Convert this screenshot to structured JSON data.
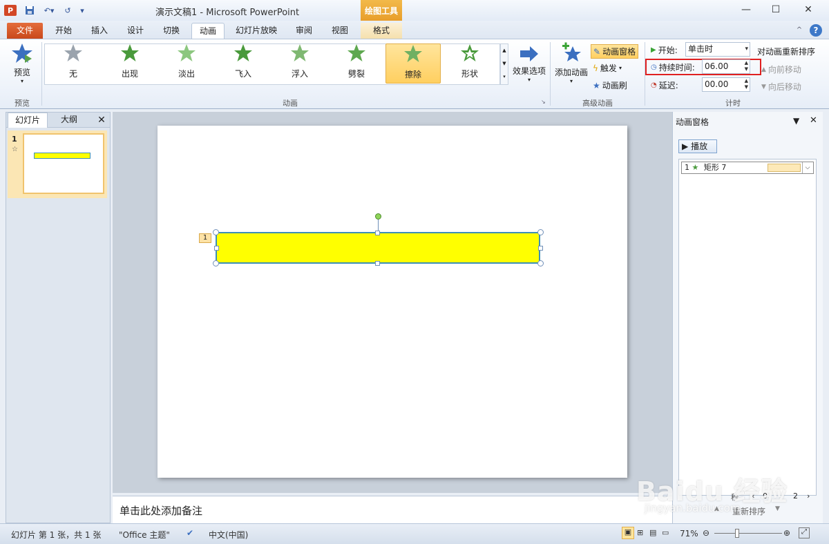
{
  "titlebar": {
    "title": "演示文稿1 - Microsoft PowerPoint",
    "context_tools": "绘图工具"
  },
  "tabs": {
    "file": "文件",
    "home": "开始",
    "insert": "插入",
    "design": "设计",
    "transitions": "切换",
    "animations": "动画",
    "slideshow": "幻灯片放映",
    "review": "审阅",
    "view": "视图",
    "format": "格式"
  },
  "ribbon": {
    "preview": {
      "button": "预览",
      "group": "预览"
    },
    "animations": [
      "无",
      "出现",
      "淡出",
      "飞入",
      "浮入",
      "劈裂",
      "擦除",
      "形状"
    ],
    "effect_options": "效果选项",
    "group_animation": "动画",
    "advanced": {
      "add": "添加动画",
      "pane": "动画窗格",
      "trigger": "触发",
      "painter": "动画刷",
      "group": "高级动画"
    },
    "timing": {
      "start_label": "开始:",
      "start_value": "单击时",
      "duration_label": "持续时间:",
      "duration_value": "06.00",
      "delay_label": "延迟:",
      "delay_value": "00.00",
      "reorder": "对动画重新排序",
      "move_earlier": "向前移动",
      "move_later": "向后移动",
      "group": "计时"
    }
  },
  "left_panel": {
    "tab_slides": "幻灯片",
    "tab_outline": "大纲",
    "slide_number": "1"
  },
  "slide": {
    "anim_badge": "1",
    "shape_fill": "#ffff00"
  },
  "notes": {
    "placeholder": "单击此处添加备注"
  },
  "anim_pane": {
    "title": "动画窗格",
    "play": "播放",
    "item_index": "1",
    "item_name": "矩形 7",
    "footer_reorder": "重新排序",
    "footer_seconds": "秒",
    "page_start": "0",
    "page_end": "2"
  },
  "status": {
    "slide_info": "幻灯片 第 1 张，共 1 张",
    "theme": "\"Office 主题\"",
    "language": "中文(中国)",
    "zoom": "71%"
  },
  "watermark": {
    "brand": "Baidu 经验",
    "url": "jingyan.baidu.com"
  }
}
